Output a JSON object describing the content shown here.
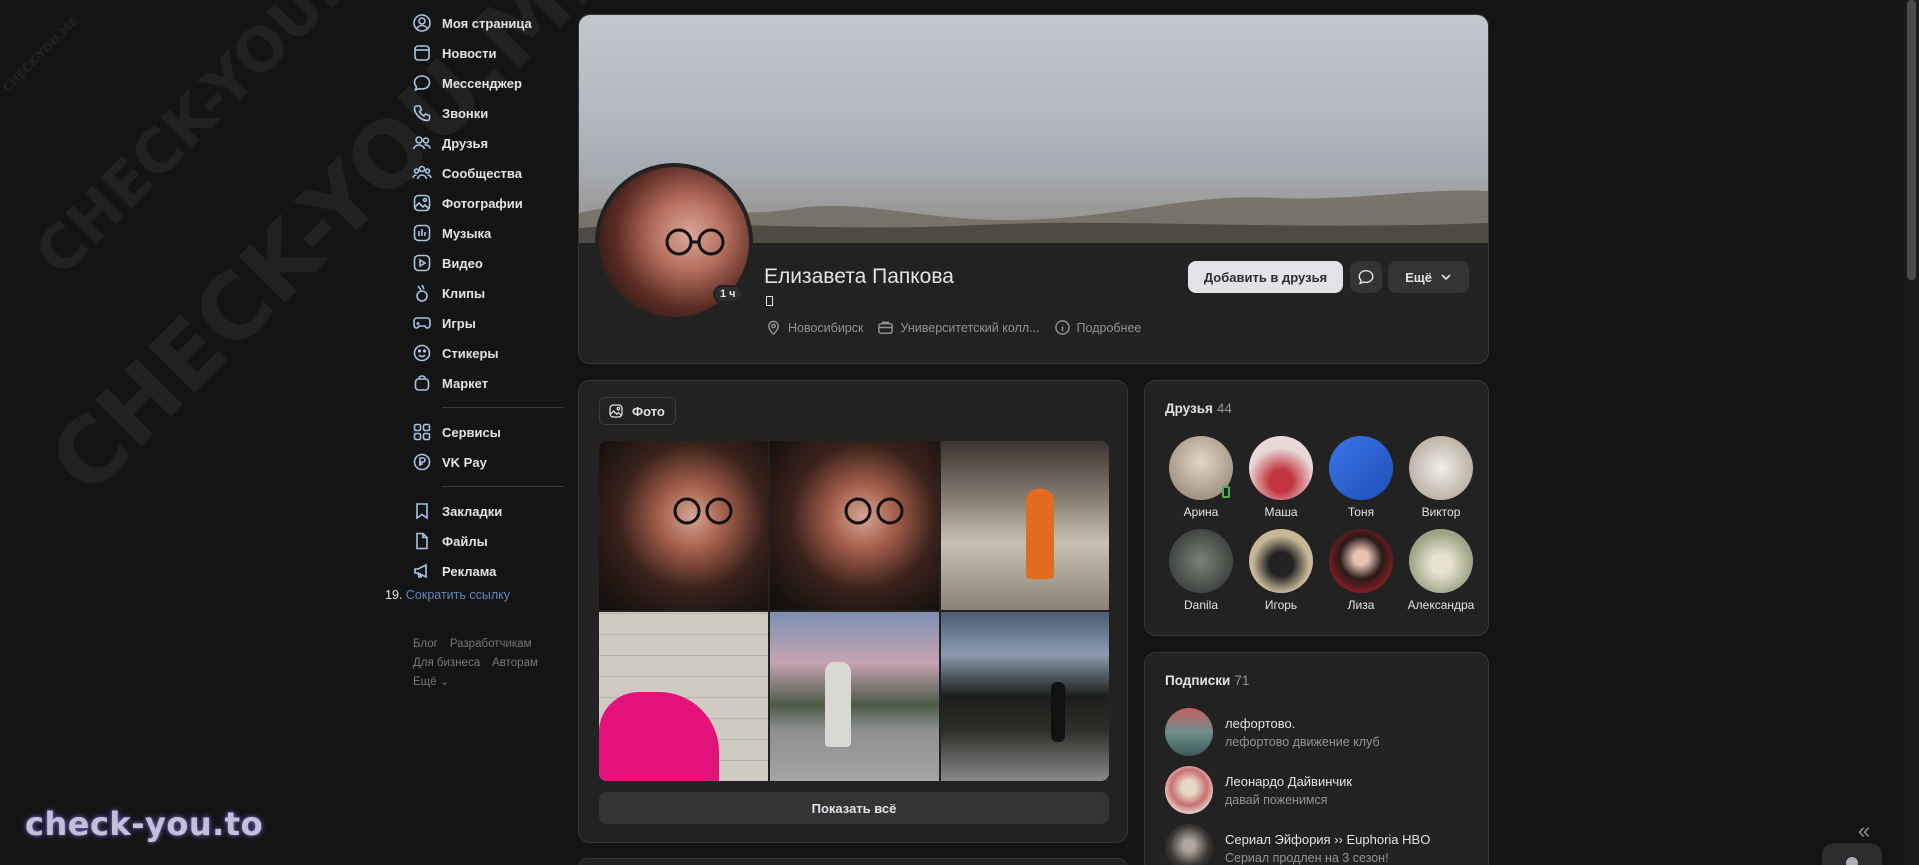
{
  "watermark": {
    "small": "CHECK-YOU.ME",
    "medium": "CHECK-YOU.ME",
    "large": "CHECK-YOU.ME",
    "bottom": "check-you.to"
  },
  "sidebar": {
    "items": [
      {
        "label": "Моя страница",
        "icon": "user-circle-icon"
      },
      {
        "label": "Новости",
        "icon": "news-icon"
      },
      {
        "label": "Мессенджер",
        "icon": "chat-icon"
      },
      {
        "label": "Звонки",
        "icon": "phone-icon"
      },
      {
        "label": "Друзья",
        "icon": "friends-icon"
      },
      {
        "label": "Сообщества",
        "icon": "communities-icon"
      },
      {
        "label": "Фотографии",
        "icon": "photo-icon"
      },
      {
        "label": "Музыка",
        "icon": "music-icon"
      },
      {
        "label": "Видео",
        "icon": "video-icon"
      },
      {
        "label": "Клипы",
        "icon": "clips-icon"
      },
      {
        "label": "Игры",
        "icon": "gamepad-icon"
      },
      {
        "label": "Стикеры",
        "icon": "smile-icon"
      },
      {
        "label": "Маркет",
        "icon": "bag-icon"
      }
    ],
    "items2": [
      {
        "label": "Сервисы",
        "icon": "services-icon"
      },
      {
        "label": "VK Pay",
        "icon": "vkpay-icon"
      }
    ],
    "items3": [
      {
        "label": "Закладки",
        "icon": "bookmark-icon"
      },
      {
        "label": "Файлы",
        "icon": "file-icon"
      },
      {
        "label": "Реклама",
        "icon": "megaphone-icon"
      }
    ],
    "extra_number": "19.",
    "extra_link": "Сократить ссылку",
    "footer": {
      "blog": "Блог",
      "devs": "Разработчикам",
      "business": "Для бизнеса",
      "authors": "Авторам",
      "more": "Ещё ⌄"
    }
  },
  "profile": {
    "name": "Елизавета Папкова",
    "online": "1 ч",
    "city": "Новосибирск",
    "education": "Университетский колл...",
    "details": "Подробнее",
    "add_friend": "Добавить в друзья",
    "more": "Ещё"
  },
  "photos": {
    "tab": "Фото",
    "show_all": "Показать всё"
  },
  "friends": {
    "title": "Друзья",
    "count": "44",
    "list": [
      {
        "name": "Арина",
        "color": "#c9b9a8"
      },
      {
        "name": "Маша",
        "color": "#c2343f"
      },
      {
        "name": "Тоня",
        "color": "#2e63d6"
      },
      {
        "name": "Виктор",
        "color": "#d9d3c9"
      },
      {
        "name": "Danila",
        "color": "#555a55"
      },
      {
        "name": "Игорь",
        "color": "#a89878"
      },
      {
        "name": "Лиза",
        "color": "#8a1d24"
      },
      {
        "name": "Александра",
        "color": "#b7b89a"
      }
    ]
  },
  "subs": {
    "title": "Подписки",
    "count": "71",
    "list": [
      {
        "name": "лефортово.",
        "desc": "лефортово движение клуб"
      },
      {
        "name": "Леонардо Дайвинчик",
        "desc": "давай поженимся"
      },
      {
        "name": "Сериал Эйфория ›› Euphoria HBO",
        "desc": "Сериал продлен на 3 сезон!"
      }
    ]
  }
}
